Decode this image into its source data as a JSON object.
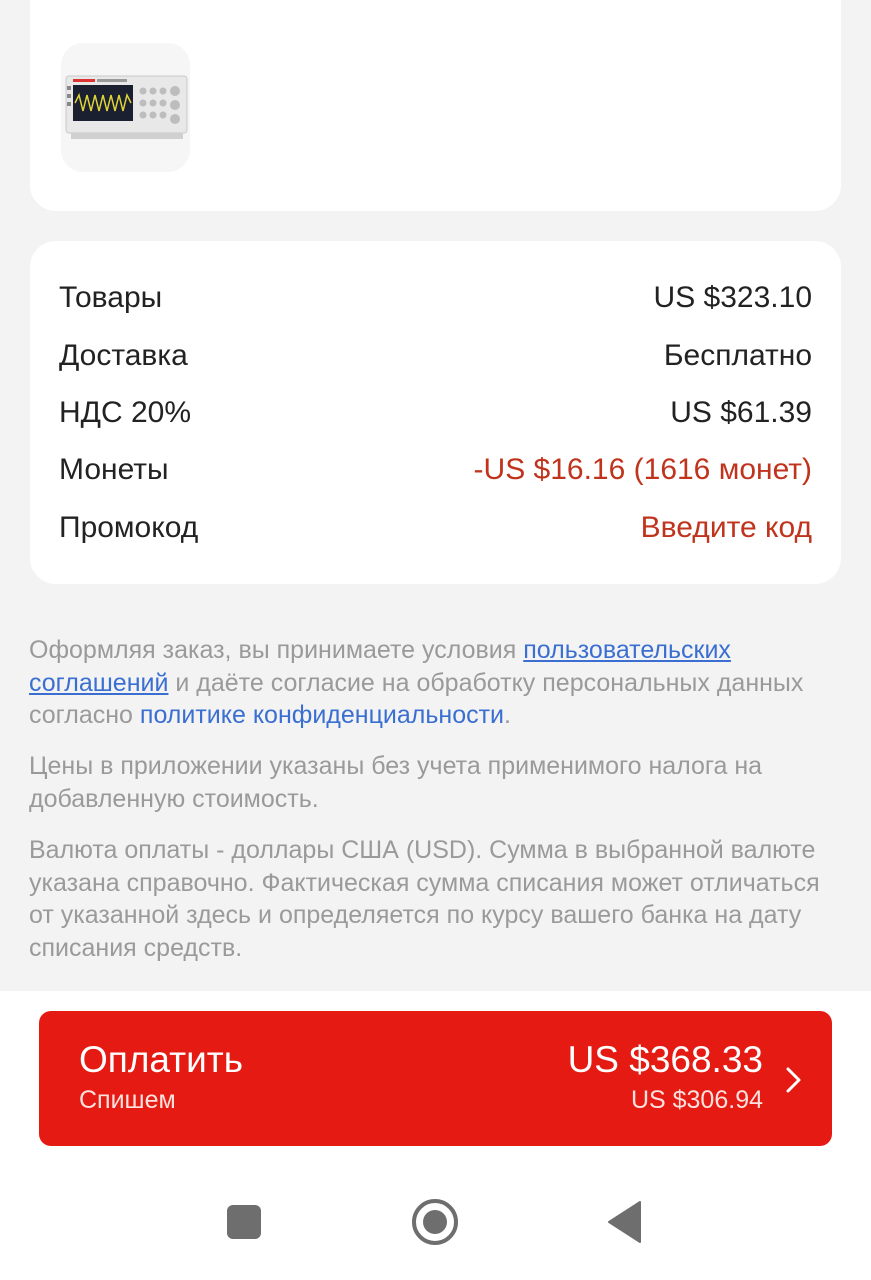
{
  "summary": {
    "rows": [
      {
        "label": "Товары",
        "value": "US $323.10"
      },
      {
        "label": "Доставка",
        "value": "Бесплатно"
      },
      {
        "label": "НДС 20%",
        "value": "US $61.39"
      },
      {
        "label": "Монеты",
        "value": "-US $16.16 (1616 монет)"
      },
      {
        "label": "Промокод",
        "value": "Введите код"
      }
    ]
  },
  "legal": {
    "part1": "Оформляя заказ, вы принимаете условия ",
    "link_terms": "пользовательских соглашений",
    "part2": " и даёте согласие на обработку персональных данных согласно ",
    "link_privacy": "политике конфиденциальности",
    "part3": ".",
    "vat_note": "Цены в приложении указаны без учета применимого налога на добавленную стоимость.",
    "currency_note": "Валюта оплаты - доллары США (USD). Сумма в выбранной валюте указана справочно. Фактическая сумма списания может отличаться от указанной здесь и определяется по курсу вашего банка на дату списания средств."
  },
  "pay": {
    "title": "Оплатить",
    "subtitle": "Спишем",
    "total": "US $368.33",
    "debit": "US $306.94"
  },
  "colors": {
    "accent_red": "#e51b13",
    "discount_text": "#c0341d",
    "link_blue": "#3a6fd1"
  },
  "icons": [
    "oscilloscope-product-image",
    "chevron-right-icon",
    "nav-square-icon",
    "nav-home-icon",
    "nav-back-icon"
  ]
}
